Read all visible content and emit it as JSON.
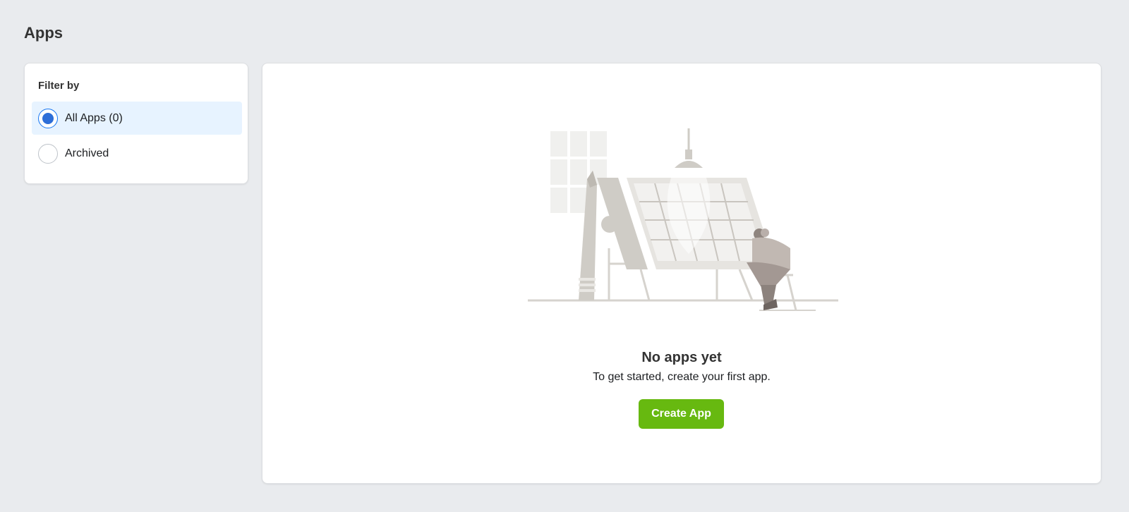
{
  "page": {
    "title": "Apps"
  },
  "filter": {
    "title": "Filter by",
    "options": [
      {
        "label": "All Apps (0)",
        "selected": true
      },
      {
        "label": "Archived",
        "selected": false
      }
    ]
  },
  "empty_state": {
    "title": "No apps yet",
    "subtitle": "To get started, create your first app.",
    "button_label": "Create App",
    "illustration": "person-at-drafting-table-illustration"
  },
  "colors": {
    "background": "#e9ebee",
    "accent": "#2d6ed8",
    "selected_bg": "#e7f3ff",
    "button": "#67b910"
  }
}
